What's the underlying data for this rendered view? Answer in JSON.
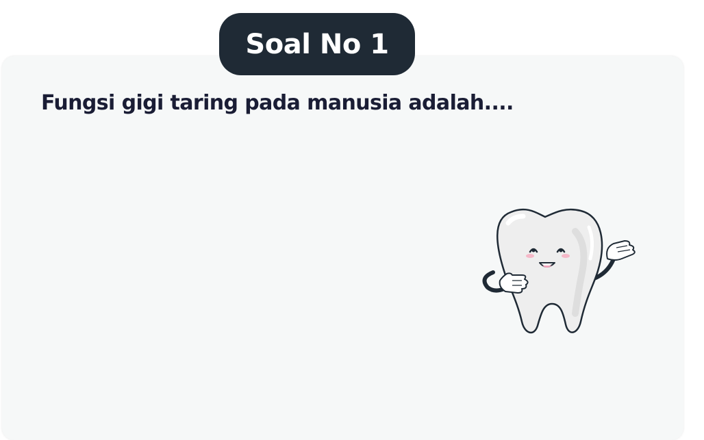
{
  "header": {
    "badge_label": "Soal No 1"
  },
  "question": {
    "text": "Fungsi gigi taring pada manusia adalah...."
  },
  "illustration": {
    "icon": "tooth-mascot-icon"
  },
  "colors": {
    "badge_background": "#1f2a35",
    "card_background": "#f6f8f8",
    "question_text": "#1a1d35"
  }
}
